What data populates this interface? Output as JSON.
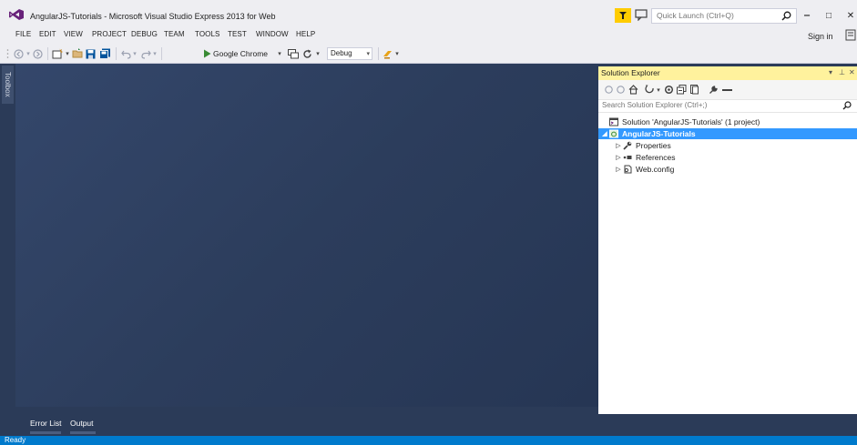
{
  "window": {
    "title": "AngularJS-Tutorials - Microsoft Visual Studio Express 2013 for Web",
    "quick_launch_placeholder": "Quick Launch (Ctrl+Q)",
    "minimize": "‒",
    "maximize": "□",
    "close": "✕"
  },
  "menu": {
    "items": [
      "FILE",
      "EDIT",
      "VIEW",
      "PROJECT",
      "DEBUG",
      "TEAM",
      "TOOLS",
      "TEST",
      "WINDOW",
      "HELP"
    ],
    "sign_in": "Sign in"
  },
  "toolbar": {
    "run_target": "Google Chrome",
    "configuration": "Debug"
  },
  "toolbox": {
    "label": "Toolbox"
  },
  "bottom_tabs": [
    "Error List",
    "Output"
  ],
  "solution_explorer": {
    "title": "Solution Explorer",
    "search_placeholder": "Search Solution Explorer (Ctrl+;)",
    "tree": [
      {
        "label": "Solution 'AngularJS-Tutorials' (1 project)",
        "level": 0,
        "icon": "solution-icon",
        "expander": "",
        "selected": false
      },
      {
        "label": "AngularJS-Tutorials",
        "level": 0,
        "icon": "web-project-icon",
        "expander": "◢",
        "selected": true
      },
      {
        "label": "Properties",
        "level": 1,
        "icon": "wrench-icon",
        "expander": "▷",
        "selected": false
      },
      {
        "label": "References",
        "level": 1,
        "icon": "references-icon",
        "expander": "▷",
        "selected": false
      },
      {
        "label": "Web.config",
        "level": 1,
        "icon": "config-file-icon",
        "expander": "▷",
        "selected": false
      }
    ]
  },
  "status": {
    "text": "Ready"
  },
  "colors": {
    "accent": "#007acc",
    "selection": "#3399ff",
    "panel_header": "#fff29d",
    "editor_bg": "#2b3b58",
    "notification": "#ffcc00"
  }
}
